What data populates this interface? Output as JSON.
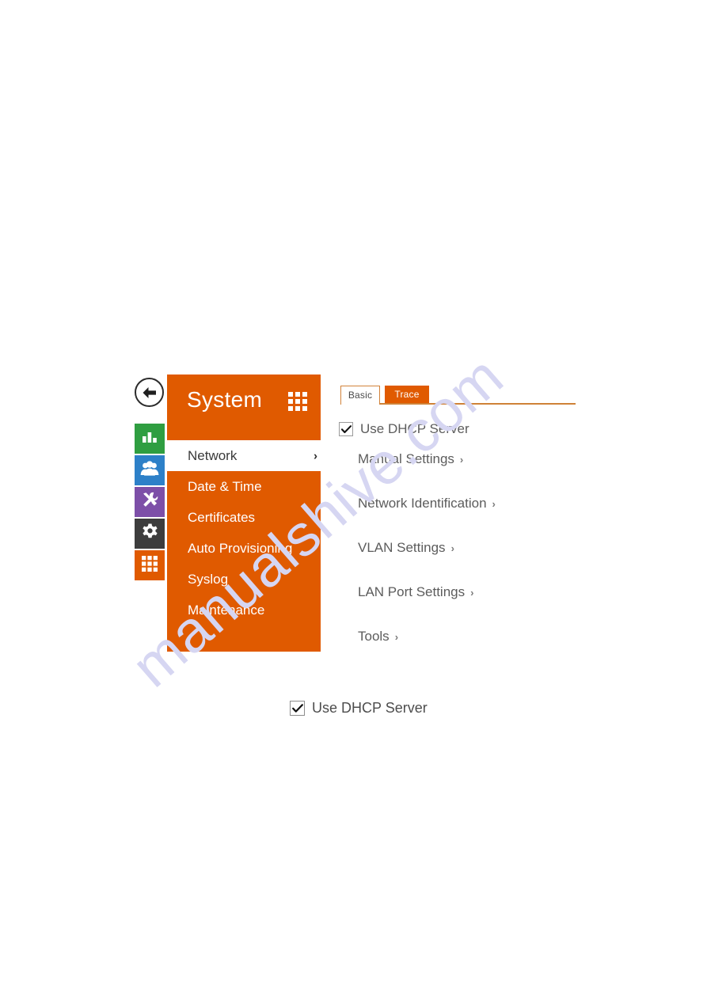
{
  "watermark": {
    "text": "manualshive.com",
    "color": "#d6d6f2"
  },
  "theme": {
    "accent_orange": "#e05a00",
    "tab_border": "#cf8237",
    "text_gray": "#5c5c5c"
  },
  "nav": {
    "back_button_icon": "arrow-left-icon",
    "icon_strip": [
      {
        "name": "status-icon",
        "glyph": "bar-chart",
        "color": "#2f9e41"
      },
      {
        "name": "directory-icon",
        "glyph": "users",
        "color": "#2d80c8"
      },
      {
        "name": "hardware-tools-icon",
        "glyph": "tools",
        "color": "#7d4fa8"
      },
      {
        "name": "system-gear-icon",
        "glyph": "gear",
        "color": "#3d3d3d"
      },
      {
        "name": "apps-grid-icon",
        "glyph": "grid",
        "color": "#e05a00"
      }
    ]
  },
  "menu_panel": {
    "title": "System",
    "grid_icon": "grid-icon",
    "items": [
      {
        "label": "Network",
        "active": true,
        "chevron": "›"
      },
      {
        "label": "Date & Time",
        "active": false,
        "chevron": ""
      },
      {
        "label": "Certificates",
        "active": false,
        "chevron": ""
      },
      {
        "label": "Auto Provisioning",
        "active": false,
        "chevron": ""
      },
      {
        "label": "Syslog",
        "active": false,
        "chevron": ""
      },
      {
        "label": "Maintenance",
        "active": false,
        "chevron": ""
      }
    ]
  },
  "content": {
    "tabs": [
      {
        "label": "Basic",
        "active": true
      },
      {
        "label": "Trace",
        "active": false
      }
    ],
    "dhcp_checkbox": {
      "label": "Use DHCP Server",
      "checked": true
    },
    "links": [
      {
        "label": "Manual Settings",
        "chevron": "›"
      },
      {
        "label": "Network Identification",
        "chevron": "›"
      },
      {
        "label": "VLAN Settings",
        "chevron": "›"
      },
      {
        "label": "LAN Port Settings",
        "chevron": "›"
      },
      {
        "label": "Tools",
        "chevron": "›"
      }
    ]
  },
  "standalone_checkbox": {
    "label": "Use DHCP Server",
    "checked": true
  }
}
